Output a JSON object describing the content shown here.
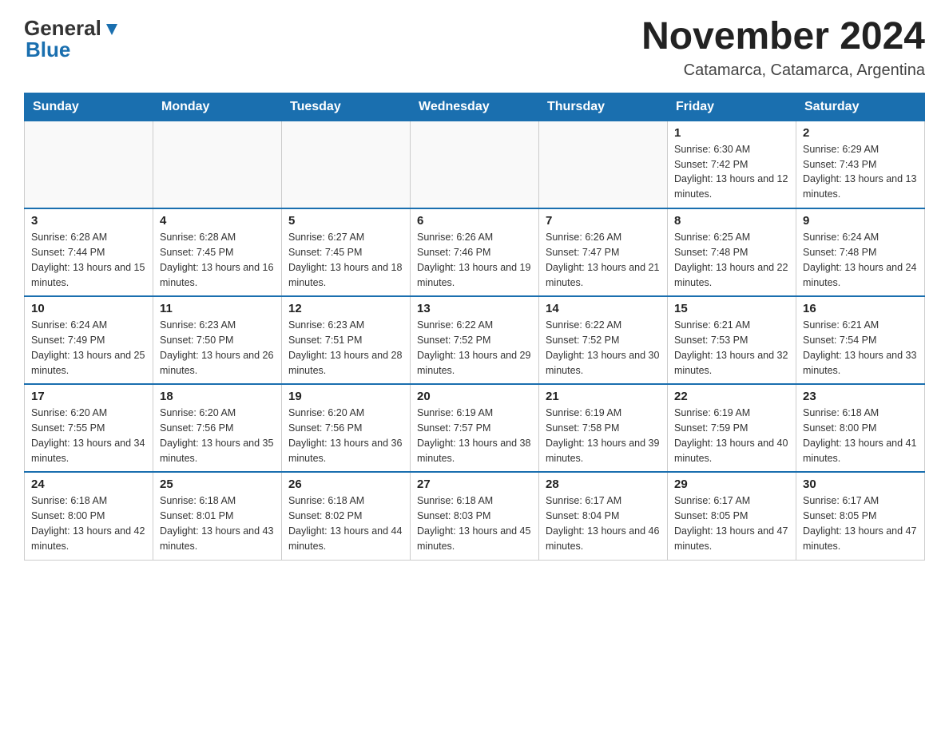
{
  "header": {
    "logo_line1": "General",
    "logo_line2": "Blue",
    "month_title": "November 2024",
    "location": "Catamarca, Catamarca, Argentina"
  },
  "weekdays": [
    "Sunday",
    "Monday",
    "Tuesday",
    "Wednesday",
    "Thursday",
    "Friday",
    "Saturday"
  ],
  "weeks": [
    [
      {
        "day": "",
        "info": ""
      },
      {
        "day": "",
        "info": ""
      },
      {
        "day": "",
        "info": ""
      },
      {
        "day": "",
        "info": ""
      },
      {
        "day": "",
        "info": ""
      },
      {
        "day": "1",
        "info": "Sunrise: 6:30 AM\nSunset: 7:42 PM\nDaylight: 13 hours and 12 minutes."
      },
      {
        "day": "2",
        "info": "Sunrise: 6:29 AM\nSunset: 7:43 PM\nDaylight: 13 hours and 13 minutes."
      }
    ],
    [
      {
        "day": "3",
        "info": "Sunrise: 6:28 AM\nSunset: 7:44 PM\nDaylight: 13 hours and 15 minutes."
      },
      {
        "day": "4",
        "info": "Sunrise: 6:28 AM\nSunset: 7:45 PM\nDaylight: 13 hours and 16 minutes."
      },
      {
        "day": "5",
        "info": "Sunrise: 6:27 AM\nSunset: 7:45 PM\nDaylight: 13 hours and 18 minutes."
      },
      {
        "day": "6",
        "info": "Sunrise: 6:26 AM\nSunset: 7:46 PM\nDaylight: 13 hours and 19 minutes."
      },
      {
        "day": "7",
        "info": "Sunrise: 6:26 AM\nSunset: 7:47 PM\nDaylight: 13 hours and 21 minutes."
      },
      {
        "day": "8",
        "info": "Sunrise: 6:25 AM\nSunset: 7:48 PM\nDaylight: 13 hours and 22 minutes."
      },
      {
        "day": "9",
        "info": "Sunrise: 6:24 AM\nSunset: 7:48 PM\nDaylight: 13 hours and 24 minutes."
      }
    ],
    [
      {
        "day": "10",
        "info": "Sunrise: 6:24 AM\nSunset: 7:49 PM\nDaylight: 13 hours and 25 minutes."
      },
      {
        "day": "11",
        "info": "Sunrise: 6:23 AM\nSunset: 7:50 PM\nDaylight: 13 hours and 26 minutes."
      },
      {
        "day": "12",
        "info": "Sunrise: 6:23 AM\nSunset: 7:51 PM\nDaylight: 13 hours and 28 minutes."
      },
      {
        "day": "13",
        "info": "Sunrise: 6:22 AM\nSunset: 7:52 PM\nDaylight: 13 hours and 29 minutes."
      },
      {
        "day": "14",
        "info": "Sunrise: 6:22 AM\nSunset: 7:52 PM\nDaylight: 13 hours and 30 minutes."
      },
      {
        "day": "15",
        "info": "Sunrise: 6:21 AM\nSunset: 7:53 PM\nDaylight: 13 hours and 32 minutes."
      },
      {
        "day": "16",
        "info": "Sunrise: 6:21 AM\nSunset: 7:54 PM\nDaylight: 13 hours and 33 minutes."
      }
    ],
    [
      {
        "day": "17",
        "info": "Sunrise: 6:20 AM\nSunset: 7:55 PM\nDaylight: 13 hours and 34 minutes."
      },
      {
        "day": "18",
        "info": "Sunrise: 6:20 AM\nSunset: 7:56 PM\nDaylight: 13 hours and 35 minutes."
      },
      {
        "day": "19",
        "info": "Sunrise: 6:20 AM\nSunset: 7:56 PM\nDaylight: 13 hours and 36 minutes."
      },
      {
        "day": "20",
        "info": "Sunrise: 6:19 AM\nSunset: 7:57 PM\nDaylight: 13 hours and 38 minutes."
      },
      {
        "day": "21",
        "info": "Sunrise: 6:19 AM\nSunset: 7:58 PM\nDaylight: 13 hours and 39 minutes."
      },
      {
        "day": "22",
        "info": "Sunrise: 6:19 AM\nSunset: 7:59 PM\nDaylight: 13 hours and 40 minutes."
      },
      {
        "day": "23",
        "info": "Sunrise: 6:18 AM\nSunset: 8:00 PM\nDaylight: 13 hours and 41 minutes."
      }
    ],
    [
      {
        "day": "24",
        "info": "Sunrise: 6:18 AM\nSunset: 8:00 PM\nDaylight: 13 hours and 42 minutes."
      },
      {
        "day": "25",
        "info": "Sunrise: 6:18 AM\nSunset: 8:01 PM\nDaylight: 13 hours and 43 minutes."
      },
      {
        "day": "26",
        "info": "Sunrise: 6:18 AM\nSunset: 8:02 PM\nDaylight: 13 hours and 44 minutes."
      },
      {
        "day": "27",
        "info": "Sunrise: 6:18 AM\nSunset: 8:03 PM\nDaylight: 13 hours and 45 minutes."
      },
      {
        "day": "28",
        "info": "Sunrise: 6:17 AM\nSunset: 8:04 PM\nDaylight: 13 hours and 46 minutes."
      },
      {
        "day": "29",
        "info": "Sunrise: 6:17 AM\nSunset: 8:05 PM\nDaylight: 13 hours and 47 minutes."
      },
      {
        "day": "30",
        "info": "Sunrise: 6:17 AM\nSunset: 8:05 PM\nDaylight: 13 hours and 47 minutes."
      }
    ]
  ]
}
